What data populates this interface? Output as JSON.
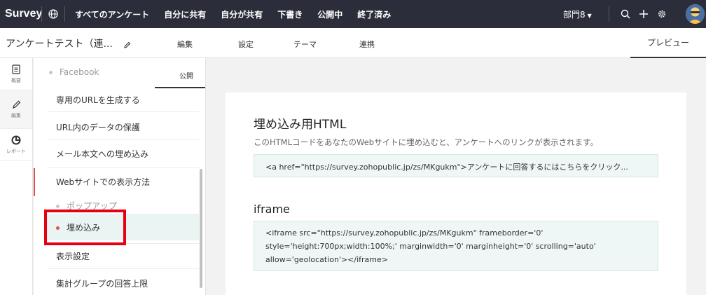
{
  "topnav": {
    "brand": "Survey",
    "items": [
      "すべてのアンケート",
      "自分に共有",
      "自分が共有",
      "下書き",
      "公開中",
      "終了済み"
    ],
    "department": "部門8"
  },
  "subheader": {
    "survey_title": "アンケートテスト（連...",
    "tabs": [
      "編集",
      "設定",
      "テーマ",
      "連携"
    ],
    "preview": "プレビュー"
  },
  "rail": {
    "items": [
      {
        "label": "概要",
        "icon": "document-icon"
      },
      {
        "label": "編集",
        "icon": "pencil-icon"
      },
      {
        "label": "レポート",
        "icon": "pie-chart-icon"
      }
    ]
  },
  "panel": {
    "facebook": "Facebook",
    "publish_tab": "公開",
    "gen_url": "専用のURLを生成する",
    "url_protect": "URL内のデータの保護",
    "mail_embed": "メール本文への埋め込み",
    "web_display": "Webサイトでの表示方法",
    "popup": "ポップアップ",
    "embed": "埋め込み",
    "display_settings": "表示設定",
    "group_limit": "集計グループの回答上限"
  },
  "content": {
    "embed_title": "埋め込み用HTML",
    "embed_desc": "このHTMLコードをあなたのWebサイトに埋め込むと、アンケートへのリンクが表示されます。",
    "embed_code": "<a href=\"https://survey.zohopublic.jp/zs/MKgukm\">アンケートに回答するにはこちらをクリック...",
    "iframe_title": "iframe",
    "iframe_line1": "<iframe src=\"https://survey.zohopublic.jp/zs/MKgukm\" frameborder='0'",
    "iframe_line2": "style='height:700px;width:100%;' marginwidth='0' marginheight='0' scrolling='auto'",
    "iframe_line3": "allow='geolocation'></iframe>"
  }
}
